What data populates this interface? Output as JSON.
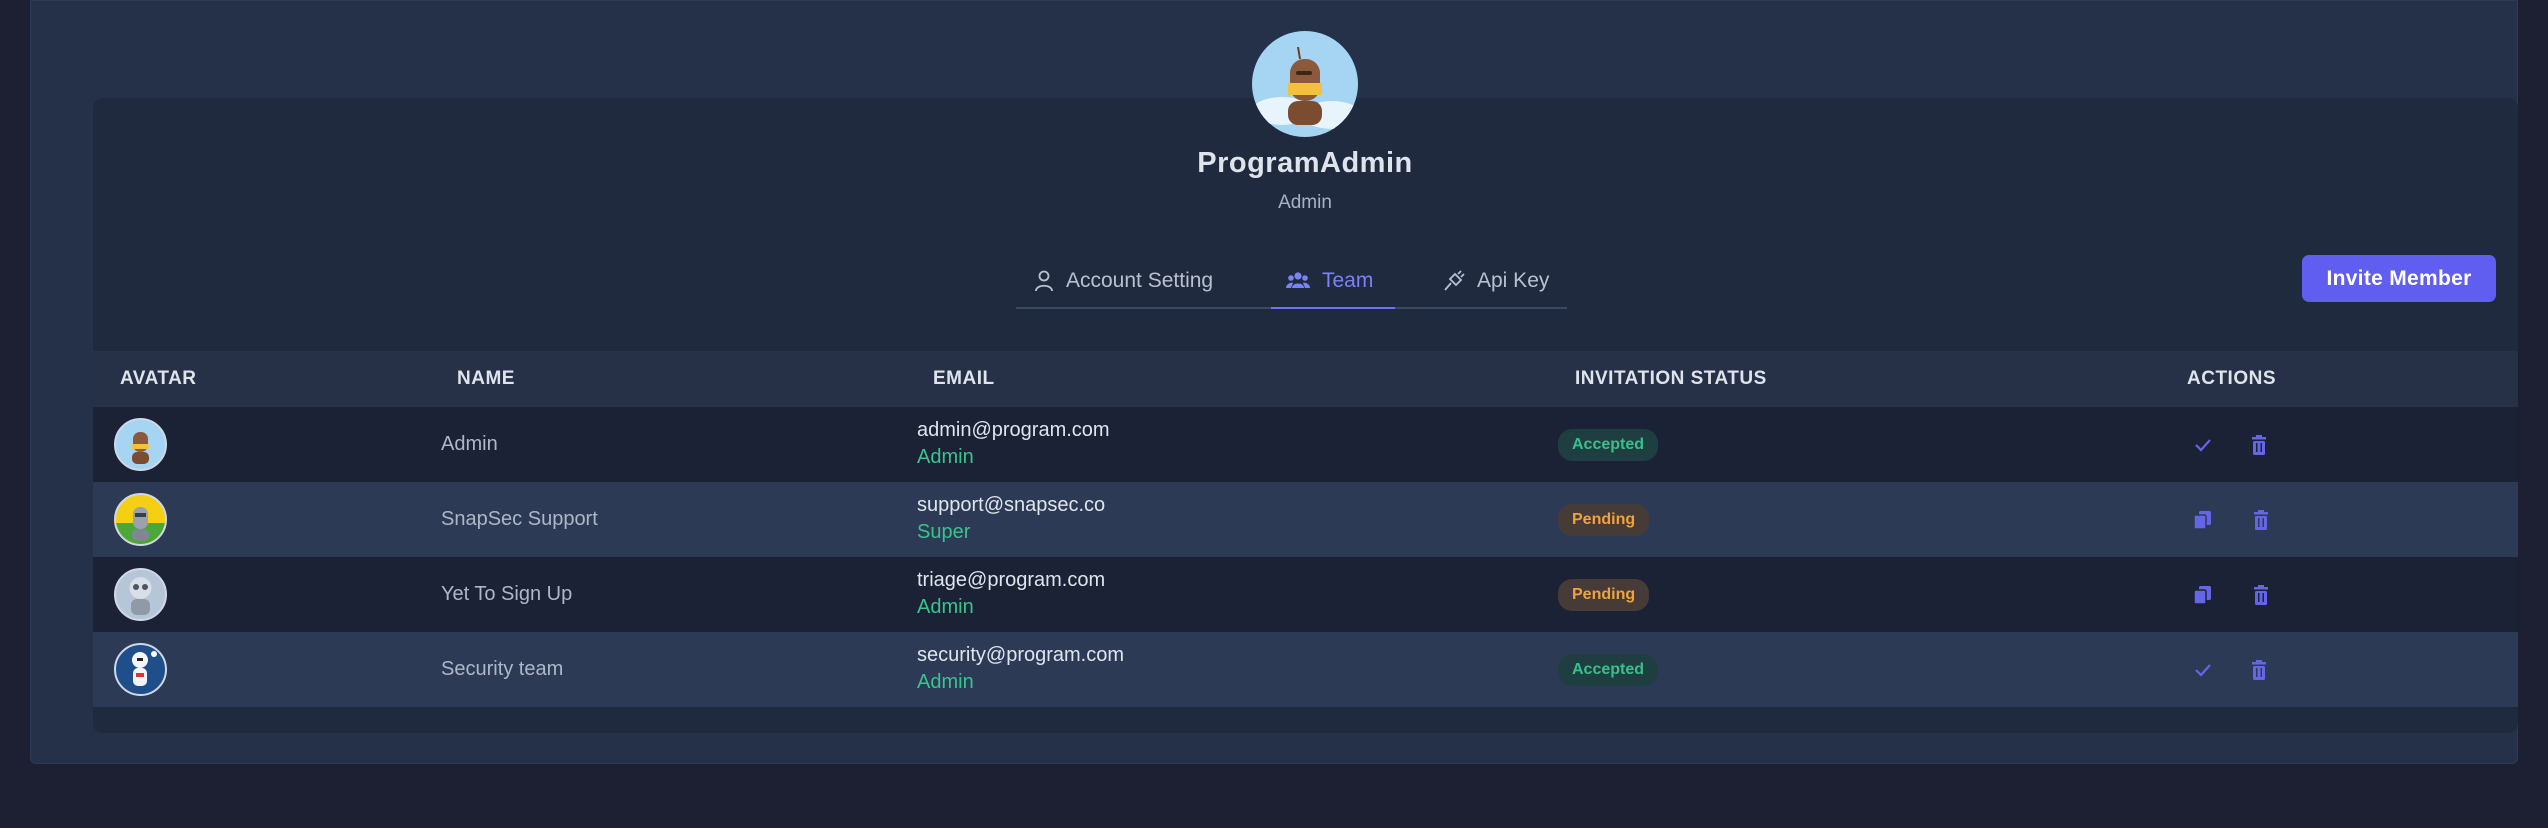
{
  "profile": {
    "name": "ProgramAdmin",
    "role": "Admin"
  },
  "tabs": [
    {
      "label": "Account Setting",
      "icon": "user-icon"
    },
    {
      "label": "Team",
      "icon": "users-icon",
      "active": true
    },
    {
      "label": "Api Key",
      "icon": "plug-icon"
    }
  ],
  "invite_button": "Invite Member",
  "table": {
    "headers": [
      "AVATAR",
      "NAME",
      "EMAIL",
      "INVITATION STATUS",
      "ACTIONS"
    ],
    "rows": [
      {
        "name": "Admin",
        "email": "admin@program.com",
        "role": "Admin",
        "status": "Accepted",
        "first_action": "check-icon"
      },
      {
        "name": "SnapSec Support",
        "email": "support@snapsec.co",
        "role": "Super",
        "status": "Pending",
        "first_action": "copy-icon"
      },
      {
        "name": "Yet To Sign Up",
        "email": "triage@program.com",
        "role": "Admin",
        "status": "Pending",
        "first_action": "copy-icon"
      },
      {
        "name": "Security team",
        "email": "security@program.com",
        "role": "Admin",
        "status": "Accepted",
        "first_action": "check-icon"
      }
    ]
  },
  "colors": {
    "accent": "#5f5ef0",
    "accepted": "#3bbf8a",
    "pending": "#f0a23c",
    "role": "#37c58c"
  }
}
